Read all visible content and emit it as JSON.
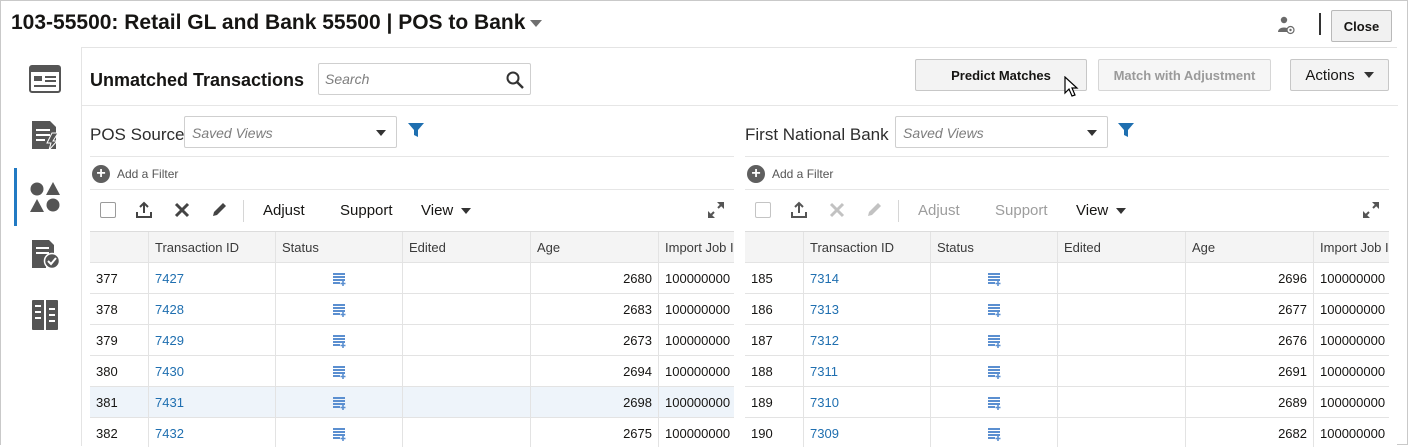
{
  "header": {
    "title": "103-55500: Retail GL and Bank 55500 | POS to Bank",
    "close_label": "Close"
  },
  "rail": {
    "items": [
      "overview-icon",
      "rules-icon",
      "shapes-icon",
      "approve-icon",
      "report-icon"
    ],
    "active_index": 2
  },
  "panel": {
    "title": "Unmatched Transactions",
    "search_placeholder": "Search",
    "predict_label": "Predict Matches",
    "match_adjust_label": "Match with Adjustment",
    "actions_label": "Actions"
  },
  "left": {
    "source_label": "POS Source",
    "saved_views_placeholder": "Saved Views",
    "add_filter_label": "Add a Filter",
    "toolbar": {
      "adjust": "Adjust",
      "support": "Support",
      "view": "View"
    },
    "columns": [
      "",
      "Transaction ID",
      "Status",
      "Edited",
      "Age",
      "Import Job I"
    ],
    "rows": [
      {
        "num": "377",
        "id": "7427",
        "age": "2680",
        "job": "100000000"
      },
      {
        "num": "378",
        "id": "7428",
        "age": "2683",
        "job": "100000000"
      },
      {
        "num": "379",
        "id": "7429",
        "age": "2673",
        "job": "100000000"
      },
      {
        "num": "380",
        "id": "7430",
        "age": "2694",
        "job": "100000000"
      },
      {
        "num": "381",
        "id": "7431",
        "age": "2698",
        "job": "100000000"
      },
      {
        "num": "382",
        "id": "7432",
        "age": "2675",
        "job": "100000000"
      }
    ]
  },
  "right": {
    "source_label": "First National Bank",
    "saved_views_placeholder": "Saved Views",
    "add_filter_label": "Add a Filter",
    "toolbar": {
      "adjust": "Adjust",
      "support": "Support",
      "view": "View"
    },
    "columns": [
      "",
      "Transaction ID",
      "Status",
      "Edited",
      "Age",
      "Import Job I"
    ],
    "rows": [
      {
        "num": "185",
        "id": "7314",
        "age": "2696",
        "job": "100000000"
      },
      {
        "num": "186",
        "id": "7313",
        "age": "2677",
        "job": "100000000"
      },
      {
        "num": "187",
        "id": "7312",
        "age": "2676",
        "job": "100000000"
      },
      {
        "num": "188",
        "id": "7311",
        "age": "2691",
        "job": "100000000"
      },
      {
        "num": "189",
        "id": "7310",
        "age": "2689",
        "job": "100000000"
      },
      {
        "num": "190",
        "id": "7309",
        "age": "2682",
        "job": "100000000"
      }
    ]
  },
  "colors": {
    "link": "#1f6fb0",
    "accent": "#227ac3",
    "status_icon": "#5b8fd0"
  }
}
